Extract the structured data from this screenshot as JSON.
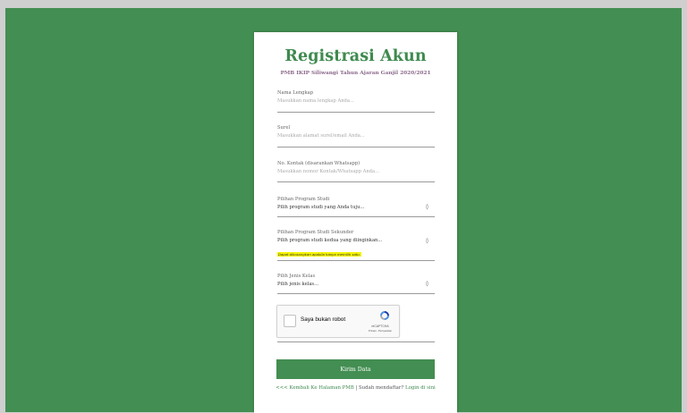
{
  "form": {
    "title": "Registrasi Akun",
    "subtitle": "PMB IKIP Siliwangi Tahun Ajaran Ganjil 2020/2021",
    "fields": [
      {
        "label": "Nama Lengkap",
        "placeholder": "Masukkan nama lengkap Anda..."
      },
      {
        "label": "Surel",
        "placeholder": "Masukkan alamat surel/email Anda..."
      },
      {
        "label": "No. Kontak (disarankan Whatsapp)",
        "placeholder": "Masukkan nomor Kontak/Whatsapp Anda..."
      }
    ],
    "selects": [
      {
        "label": "Pilihan Program Studi",
        "value": "Pilih program studi yang Anda tuju..."
      },
      {
        "label": "Pilihan Program Studi Sekunder",
        "value": "Pilih program studi kedua yang diinginkan...",
        "hint": "Dapat dikosongkan apabila hanya memilih satu."
      },
      {
        "label": "Pilih Jenis Kelas",
        "value": "Pilih jenis kelas..."
      }
    ],
    "select_indicator": "◊",
    "recaptcha": {
      "label": "Saya bukan robot",
      "brand": "reCAPTCHA",
      "terms": "Privasi - Persyaratan"
    },
    "submit_label": "Kirim Data",
    "footer": {
      "back_link": "<<< Kembali Ke Halaman PMB",
      "separator": " | Sudah mendaftar? ",
      "login_link": "Login di sini"
    }
  },
  "colors": {
    "accent": "#438e52",
    "background": "#cfcfcf",
    "hint_highlight": "#f4f400"
  }
}
